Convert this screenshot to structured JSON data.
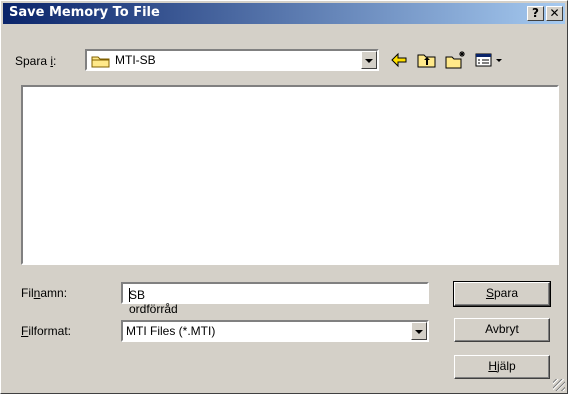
{
  "window": {
    "title": "Save Memory To File"
  },
  "titlebar": {
    "help_glyph": "?",
    "close_glyph": "✕"
  },
  "save_in": {
    "label_pre": "Spara ",
    "label_key": "i",
    "label_post": ":",
    "value": "MTI-SB"
  },
  "filename": {
    "label_pre": "Fil",
    "label_key": "n",
    "label_post": "amn:",
    "value": "SB ordförråd"
  },
  "filetype": {
    "label_key": "F",
    "label_post": "ilformat:",
    "value": "MTI Files (*.MTI)"
  },
  "buttons": {
    "save_key": "S",
    "save_rest": "para",
    "cancel": "Avbryt",
    "help_key": "H",
    "help_rest": "jälp"
  }
}
